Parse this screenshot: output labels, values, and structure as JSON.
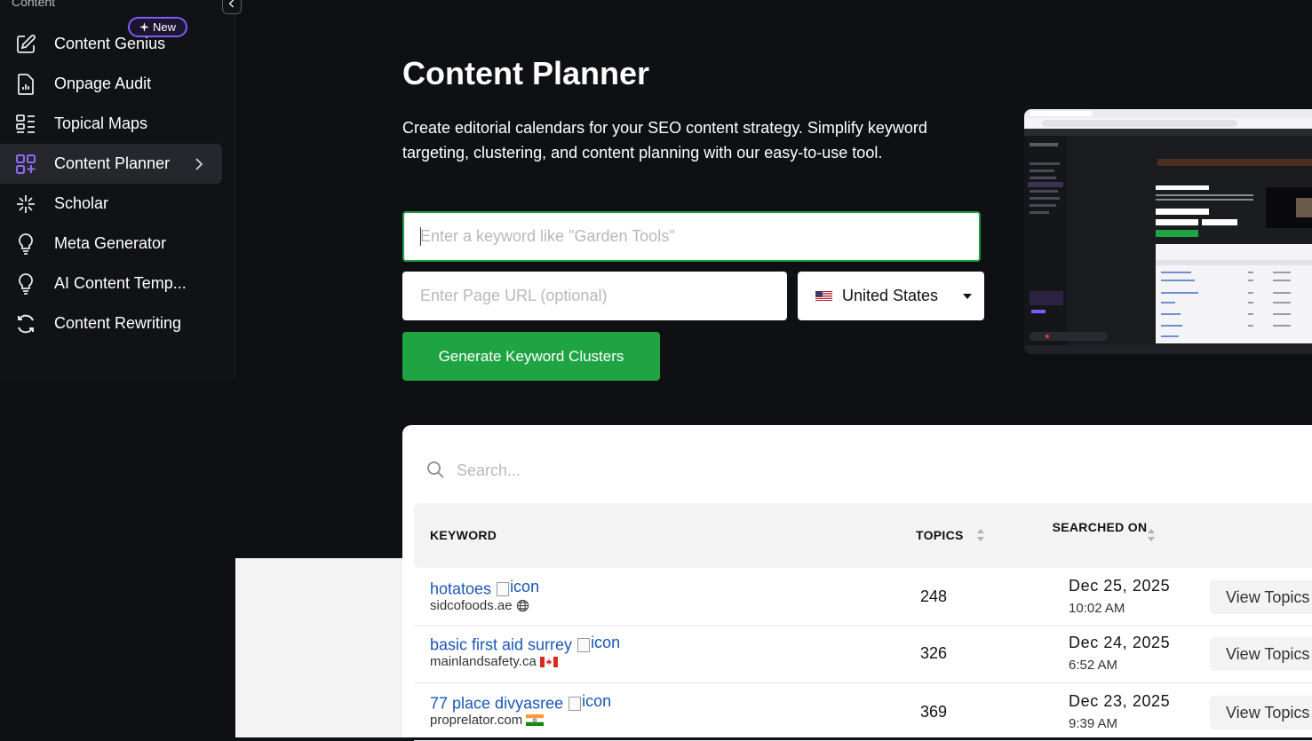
{
  "sidebar": {
    "section_label": "Content",
    "new_badge": "New",
    "items": [
      {
        "label": "Content Genius",
        "icon": "edit-icon"
      },
      {
        "label": "Onpage Audit",
        "icon": "report-icon"
      },
      {
        "label": "Topical Maps",
        "icon": "grid-list-icon"
      },
      {
        "label": "Content Planner",
        "icon": "grid-plus-icon",
        "active": true
      },
      {
        "label": "Scholar",
        "icon": "sparkle-icon"
      },
      {
        "label": "Meta Generator",
        "icon": "lightbulb-icon"
      },
      {
        "label": "AI Content Temp...",
        "icon": "lightbulb-icon"
      },
      {
        "label": "Content Rewriting",
        "icon": "refresh-icon"
      }
    ]
  },
  "main": {
    "title": "Content Planner",
    "description": "Create editorial calendars for your SEO content strategy. Simplify keyword targeting, clustering, and content planning with our easy-to-use tool.",
    "keyword_placeholder": "Enter a keyword like \"Garden Tools\"",
    "url_placeholder": "Enter Page URL (optional)",
    "country": "United States",
    "generate_label": "Generate Keyword Clusters"
  },
  "table": {
    "search_placeholder": "Search...",
    "headers": {
      "keyword": "KEYWORD",
      "topics": "TOPICS",
      "searched_on": "SEARCHED ON"
    },
    "rows": [
      {
        "keyword": "hotatoes",
        "img_alt": "icon",
        "domain": "sidcofoods.ae",
        "marker": "globe-icon",
        "topics": "248",
        "date": "Dec 25, 2025",
        "time": "10:02 AM",
        "action": "View Topics"
      },
      {
        "keyword": "basic first aid surrey",
        "img_alt": "icon",
        "domain": "mainlandsafety.ca",
        "marker": "canada-flag-icon",
        "topics": "326",
        "date": "Dec 24, 2025",
        "time": "6:52 AM",
        "action": "View Topics"
      },
      {
        "keyword": "77 place divyasree",
        "img_alt": "icon",
        "domain": "proprelator.com",
        "marker": "india-flag-icon",
        "topics": "369",
        "date": "Dec 23, 2025",
        "time": "9:39 AM",
        "action": "View Topics"
      }
    ]
  },
  "colors": {
    "accent_green": "#1fa444",
    "link_blue": "#1a56b8",
    "badge_purple": "#7b5cf6",
    "icon_purple": "#8b6cf8"
  }
}
